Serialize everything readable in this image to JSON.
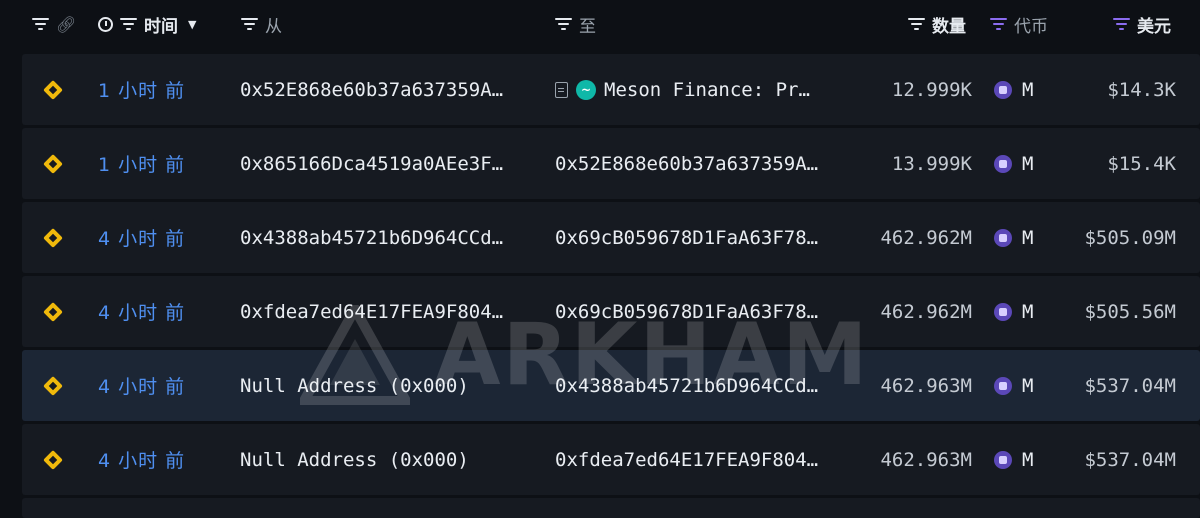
{
  "header": {
    "time_label": "时间",
    "from_label": "从",
    "to_label": "至",
    "amount_label": "数量",
    "token_label": "代币",
    "usd_label": "美元"
  },
  "rows": [
    {
      "time": "1 小时 前",
      "from": "0x52E868e60b37a637359A…",
      "to": "Meson Finance: Pr…",
      "to_has_icons": true,
      "amount": "12.999K",
      "token": "M",
      "usd": "$14.3K"
    },
    {
      "time": "1 小时 前",
      "from": "0x865166Dca4519a0AEe3F…",
      "to": "0x52E868e60b37a637359A…",
      "amount": "13.999K",
      "token": "M",
      "usd": "$15.4K"
    },
    {
      "time": "4 小时 前",
      "from": "0x4388ab45721b6D964CCd…",
      "to": "0x69cB059678D1FaA63F78…",
      "amount": "462.962M",
      "token": "M",
      "usd": "$505.09M"
    },
    {
      "time": "4 小时 前",
      "from": "0xfdea7ed64E17FEA9F804…",
      "to": "0x69cB059678D1FaA63F78…",
      "amount": "462.962M",
      "token": "M",
      "usd": "$505.56M"
    },
    {
      "time": "4 小时 前",
      "from": "Null Address (0x000)",
      "to": "0x4388ab45721b6D964CCd…",
      "amount": "462.963M",
      "token": "M",
      "usd": "$537.04M"
    },
    {
      "time": "4 小时 前",
      "from": "Null Address (0x000)",
      "to": "0xfdea7ed64E17FEA9F804…",
      "amount": "462.963M",
      "token": "M",
      "usd": "$537.04M"
    }
  ],
  "watermark": "ARKHAM",
  "colors": {
    "time_link": "#4f8ff0",
    "chain_icon": "#f0b90b",
    "token_icon": "#5b48b8",
    "selected_row": "#1c2635"
  }
}
